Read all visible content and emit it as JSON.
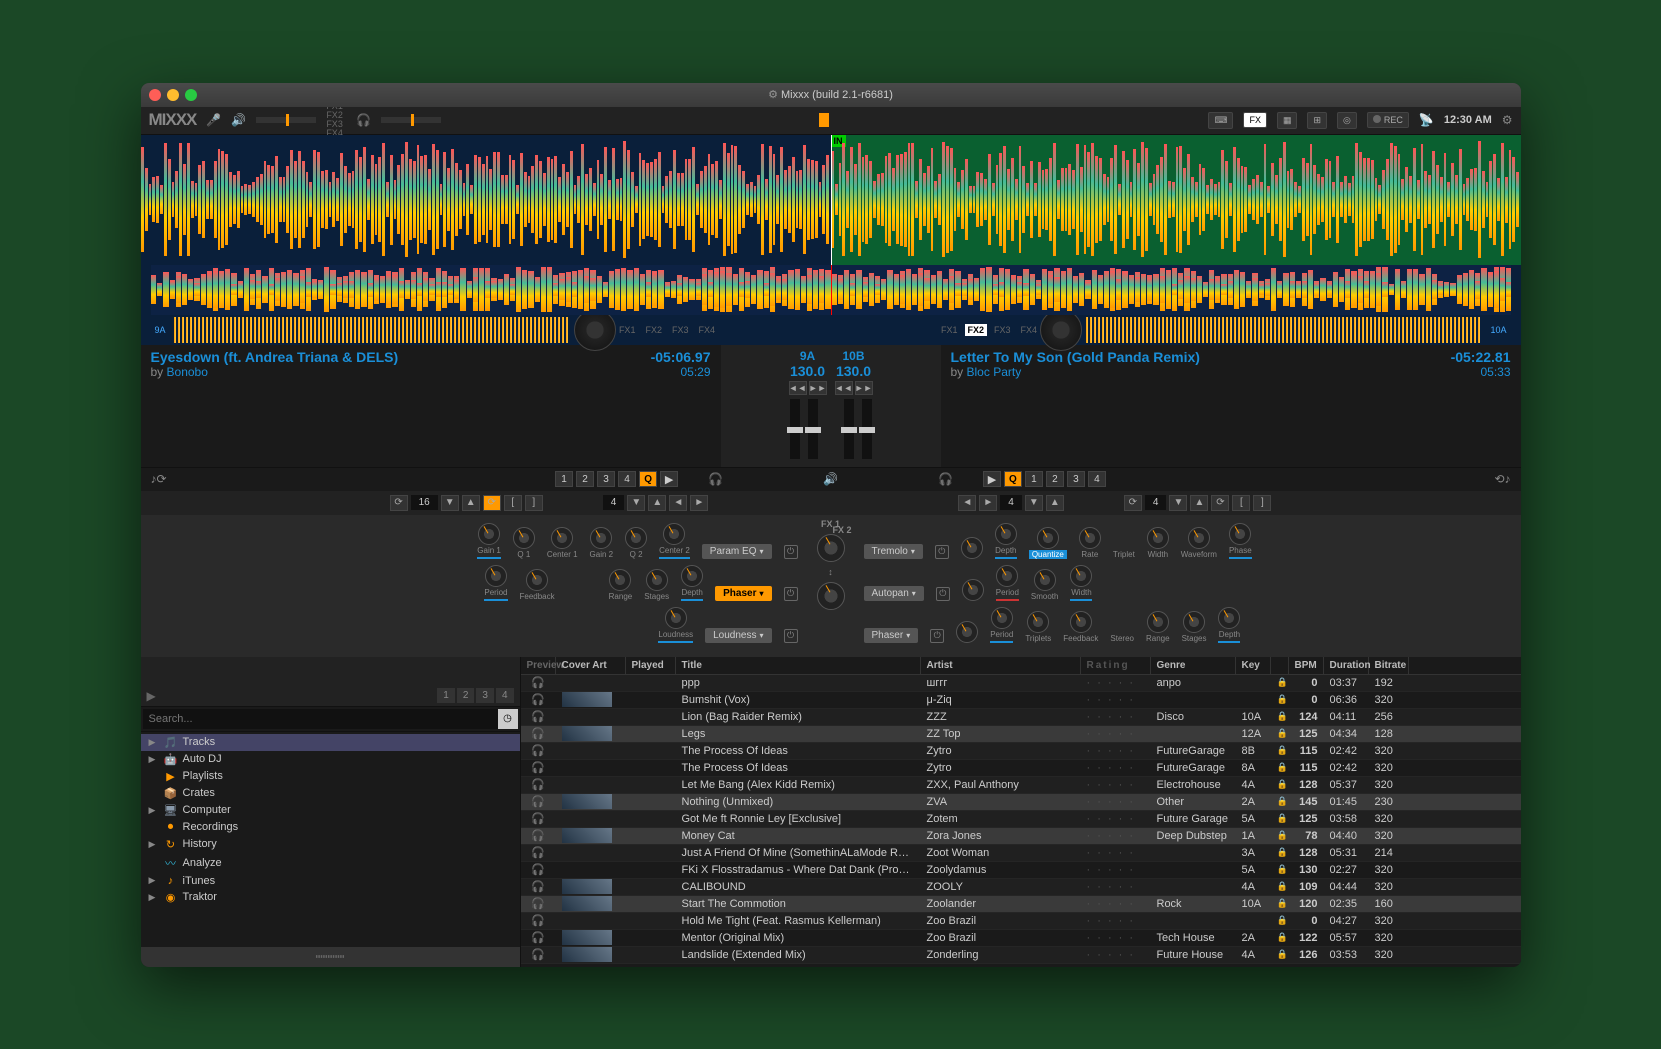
{
  "window_title": "Mixxx (build 2.1-r6681)",
  "logo": "MIXXX",
  "clock": "12:30 AM",
  "rec_label": "REC",
  "fx_badge": "FX",
  "toolbar_fx_lines": [
    "FX1 FX2",
    "FX3 FX4"
  ],
  "search_placeholder": "Search...",
  "headers": {
    "preview": "Preview",
    "cover": "Cover Art",
    "played": "Played",
    "title": "Title",
    "artist": "Artist",
    "rating": "Rating",
    "genre": "Genre",
    "key": "Key",
    "bpm": "BPM",
    "duration": "Duration",
    "bitrate": "Bitrate"
  },
  "deck1": {
    "title": "Eyesdown (ft. Andrea Triana & DELS)",
    "artist": "Bonobo",
    "remaining": "-05:06.97",
    "duration": "05:29",
    "key": "9A",
    "bpm": "130.0",
    "q_key": "9A",
    "fx": [
      "FX1",
      "FX2",
      "FX3",
      "FX4"
    ]
  },
  "deck2": {
    "title": "Letter To My Son (Gold Panda Remix)",
    "artist": "Bloc Party",
    "remaining": "-05:22.81",
    "duration": "05:33",
    "key": "10B",
    "bpm": "130.0",
    "q_key": "10A",
    "fx": [
      "FX1",
      "FX2",
      "FX3",
      "FX4"
    ]
  },
  "cues": [
    "1",
    "2",
    "3",
    "4"
  ],
  "loop1": "16",
  "loop1_fx": "4",
  "loop2_fx": "4",
  "loop2": "4",
  "fx_center": {
    "left": "FX 1",
    "right": "FX 2"
  },
  "fx_left": {
    "row1": {
      "knobs": [
        "Gain 1",
        "Q 1",
        "Center 1",
        "Gain 2",
        "Q 2",
        "Center 2"
      ],
      "select": "Param EQ"
    },
    "row2": {
      "knobs": [
        "Period",
        "Feedback",
        "Range",
        "Stages",
        "Depth"
      ],
      "select": "Phaser",
      "active": true,
      "gap_after": 2
    },
    "row3": {
      "knobs": [
        "Loudness"
      ],
      "select": "Loudness"
    }
  },
  "fx_right": {
    "row1": {
      "select": "Tremolo",
      "knobs": [
        "Depth",
        "Quantize",
        "Rate",
        "Width",
        "Waveform",
        "Phase"
      ],
      "blue": "Quantize",
      "triplet": "Triplet"
    },
    "row2": {
      "select": "Autopan",
      "knobs": [
        "Period",
        "Smooth",
        "Width"
      ],
      "red_under": true
    },
    "row3": {
      "select": "Phaser",
      "knobs": [
        "Period",
        "Triplets",
        "Feedback",
        "Range",
        "Stages",
        "Depth"
      ],
      "stereo": "Stereo"
    }
  },
  "sidebar": [
    {
      "arrow": "▶",
      "icon": "🎵",
      "label": "Tracks",
      "sel": true,
      "color": "#f90"
    },
    {
      "arrow": "▶",
      "icon": "🤖",
      "label": "Auto DJ",
      "color": "#7b5"
    },
    {
      "arrow": "",
      "icon": "▶",
      "label": "Playlists",
      "color": "#f90"
    },
    {
      "arrow": "",
      "icon": "📦",
      "label": "Crates",
      "color": "#f90"
    },
    {
      "arrow": "▶",
      "icon": "🖥",
      "label": "Computer",
      "color": "#89a"
    },
    {
      "arrow": "",
      "icon": "⏺",
      "label": "Recordings",
      "color": "#f90"
    },
    {
      "arrow": "▶",
      "icon": "↻",
      "label": "History",
      "color": "#f90"
    },
    {
      "arrow": "",
      "icon": "〰",
      "label": "Analyze",
      "color": "#3bd"
    },
    {
      "arrow": "▶",
      "icon": "♪",
      "label": "iTunes",
      "color": "#f90"
    },
    {
      "arrow": "▶",
      "icon": "◉",
      "label": "Traktor",
      "color": "#f90"
    }
  ],
  "preview_tabs": [
    "1",
    "2",
    "3",
    "4"
  ],
  "tracks": [
    {
      "title": "ppp",
      "artist": "шггг",
      "genre": "anpo",
      "key": "",
      "bpm": "0",
      "dur": "03:37",
      "bit": "192"
    },
    {
      "title": "Bumshit (Vox)",
      "artist": "μ-Ziq",
      "genre": "",
      "key": "",
      "bpm": "0",
      "dur": "06:36",
      "bit": "320"
    },
    {
      "title": "Lion (Bag Raider Remix)",
      "artist": "ZZZ",
      "genre": "Disco",
      "key": "10A",
      "bpm": "124",
      "dur": "04:11",
      "bit": "256"
    },
    {
      "title": "Legs",
      "artist": "ZZ Top",
      "genre": "",
      "key": "12A",
      "bpm": "125",
      "dur": "04:34",
      "bit": "128",
      "hl": true
    },
    {
      "title": "The Process Of Ideas",
      "artist": "Zytro",
      "genre": "FutureGarage",
      "key": "8B",
      "bpm": "115",
      "dur": "02:42",
      "bit": "320"
    },
    {
      "title": "The Process Of Ideas",
      "artist": "Zytro",
      "genre": "FutureGarage",
      "key": "8A",
      "bpm": "115",
      "dur": "02:42",
      "bit": "320"
    },
    {
      "title": "Let Me Bang (Alex Kidd Remix)",
      "artist": "ZXX, Paul Anthony",
      "genre": "Electrohouse",
      "key": "4A",
      "bpm": "128",
      "dur": "05:37",
      "bit": "320"
    },
    {
      "title": "Nothing (Unmixed)",
      "artist": "ZVA",
      "genre": "Other",
      "key": "2A",
      "bpm": "145",
      "dur": "01:45",
      "bit": "230",
      "hl": true
    },
    {
      "title": "Got Me ft Ronnie Ley [Exclusive]",
      "artist": "Zotem",
      "genre": "Future Garage",
      "key": "5A",
      "bpm": "125",
      "dur": "03:58",
      "bit": "320"
    },
    {
      "title": "Money Cat",
      "artist": "Zora Jones",
      "genre": "Deep Dubstep",
      "key": "1A",
      "bpm": "78",
      "dur": "04:40",
      "bit": "320",
      "hl": true
    },
    {
      "title": "Just A Friend Of Mine (SomethinALaMode Remix)",
      "artist": "Zoot Woman",
      "genre": "",
      "key": "3A",
      "bpm": "128",
      "dur": "05:31",
      "bit": "214"
    },
    {
      "title": "FKi X Flosstradamus - Where Dat Dank (Prod B...",
      "artist": "Zoolydamus",
      "genre": "",
      "key": "5A",
      "bpm": "130",
      "dur": "02:27",
      "bit": "320"
    },
    {
      "title": "CALIBOUND",
      "artist": "ZOOLY",
      "genre": "",
      "key": "4A",
      "bpm": "109",
      "dur": "04:44",
      "bit": "320"
    },
    {
      "title": "Start The Commotion",
      "artist": "Zoolander",
      "genre": "Rock",
      "key": "10A",
      "bpm": "120",
      "dur": "02:35",
      "bit": "160",
      "hl": true
    },
    {
      "title": "Hold Me Tight (Feat. Rasmus Kellerman)",
      "artist": "Zoo Brazil",
      "genre": "",
      "key": "",
      "bpm": "0",
      "dur": "04:27",
      "bit": "320"
    },
    {
      "title": "Mentor (Original Mix)",
      "artist": "Zoo Brazil",
      "genre": "Tech House",
      "key": "2A",
      "bpm": "122",
      "dur": "05:57",
      "bit": "320"
    },
    {
      "title": "Landslide (Extended Mix)",
      "artist": "Zonderling",
      "genre": "Future House",
      "key": "4A",
      "bpm": "126",
      "dur": "03:53",
      "bit": "320"
    }
  ],
  "cover_rows": [
    1,
    3,
    7,
    9,
    12,
    13,
    15,
    16
  ]
}
